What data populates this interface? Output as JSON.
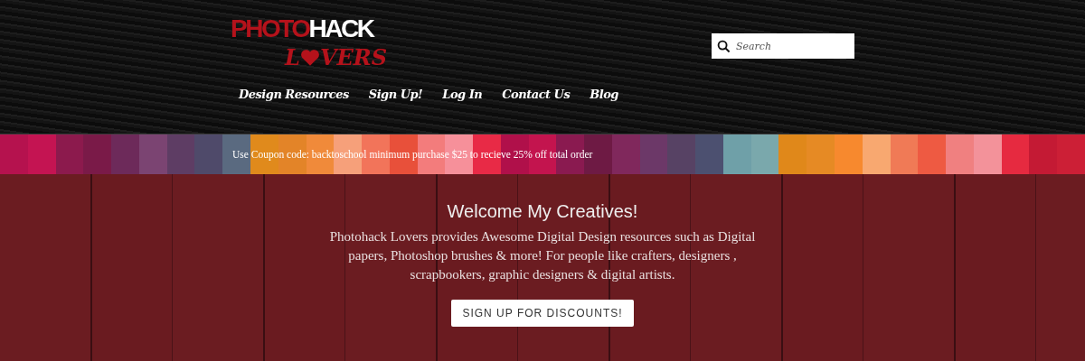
{
  "logo": {
    "word_red": "PHOTO",
    "word_white": "HACK",
    "script_start": "L",
    "script_end": "VERS"
  },
  "nav": [
    "Design Resources",
    "Sign Up!",
    "Log In",
    "Contact Us",
    "Blog"
  ],
  "search": {
    "placeholder": "Search"
  },
  "coupon_banner": {
    "text": "Use Coupon code: backtoschool minimum purchase $25 to recieve 25% off total order"
  },
  "hero": {
    "title": "Welcome My Creatives!",
    "text": "Photohack Lovers provides Awesome Digital Design resources such as  Digital papers, Photoshop brushes & more! For people like crafters, designers , scrapbookers, graphic designers & digital artists.",
    "button": "SIGN UP FOR DISCOUNTS!"
  }
}
